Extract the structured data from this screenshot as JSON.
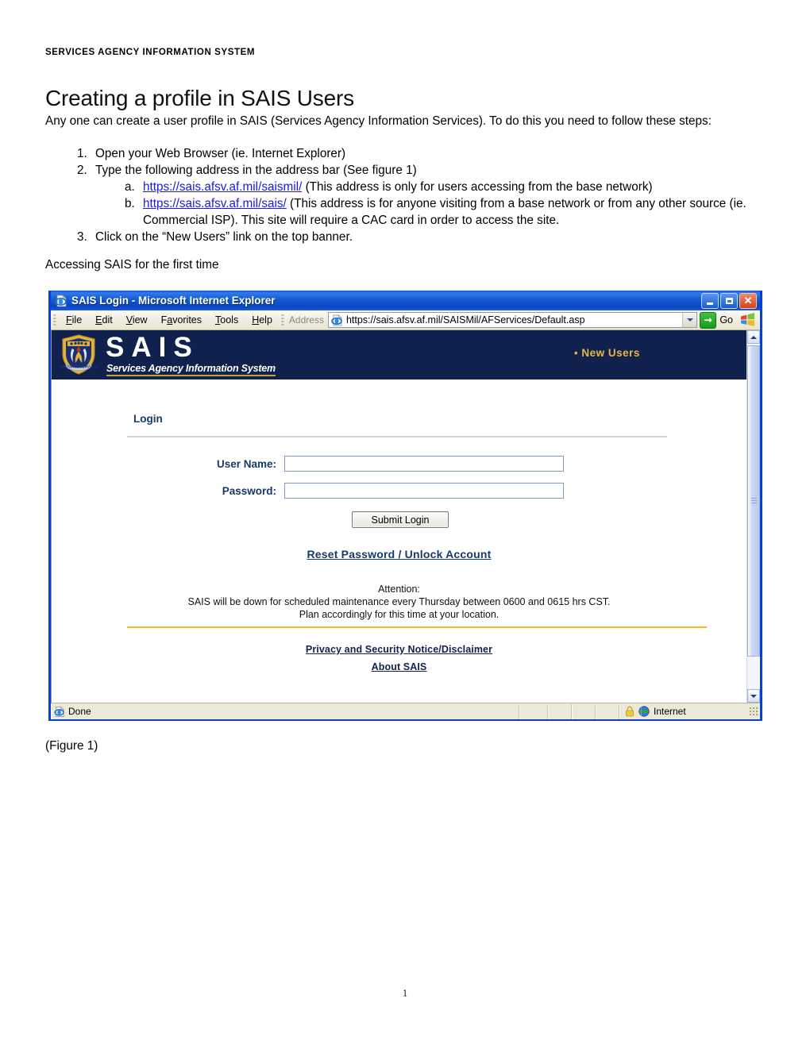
{
  "document": {
    "running_header": "SERVICES AGENCY INFORMATION SYSTEM",
    "title": "Creating a profile in SAIS Users",
    "intro": "Any one can create a user profile in SAIS (Services Agency Information Services). To do this you need to follow these steps:",
    "steps": [
      {
        "text": "Open your Web Browser (ie. Internet Explorer)"
      },
      {
        "text": "Type the following address in the address bar (See figure 1)",
        "substeps": [
          {
            "link": "https://sais.afsv.af.mil/saismil/",
            "rest": " (This address is only for users accessing from the base network)"
          },
          {
            "link": "https://sais.afsv.af.mil/sais/",
            "rest": " (This address is for anyone visiting from a base network or from any other source (ie. Commercial ISP). This site will require a CAC card in order to access the site."
          }
        ]
      },
      {
        "text": "Click on the “New Users” link on the top banner."
      }
    ],
    "section_label": "Accessing SAIS for the first time",
    "figure_caption": "(Figure 1)",
    "page_number": "1"
  },
  "browser": {
    "title": "SAIS Login - Microsoft Internet Explorer",
    "title_icon": "internet-explorer-icon",
    "window_buttons": {
      "minimize": "Minimize",
      "maximize": "Maximize",
      "close": "Close"
    },
    "menu": [
      {
        "label": "File",
        "accel": "F"
      },
      {
        "label": "Edit",
        "accel": "E"
      },
      {
        "label": "View",
        "accel": "V"
      },
      {
        "label": "Favorites",
        "accel": "a"
      },
      {
        "label": "Tools",
        "accel": "T"
      },
      {
        "label": "Help",
        "accel": "H"
      }
    ],
    "address": {
      "label": "Address",
      "value": "https://sais.afsv.af.mil/SAISMil/AFServices/Default.asp",
      "placeholder": "Address"
    },
    "go_label": "Go",
    "status": {
      "text": "Done",
      "zone": "Internet",
      "lock_icon": "padlock-icon",
      "globe_icon": "globe-icon"
    }
  },
  "sais_page": {
    "banner": {
      "wordmark": "SAIS",
      "tagline": "Services Agency Information System",
      "crest_icon": "air-force-services-crest-icon",
      "new_users_bullet": "•",
      "new_users_label": "New Users"
    },
    "login": {
      "heading": "Login",
      "username_label": "User Name:",
      "username_value": "",
      "password_label": "Password:",
      "password_value": "",
      "submit_label": "Submit Login",
      "reset_link": "Reset Password / Unlock Account"
    },
    "attention": {
      "line1": "Attention:",
      "line2": "SAIS will be down for scheduled maintenance every Thursday between 0600 and 0615 hrs CST.",
      "line3": "Plan accordingly for this time at your location."
    },
    "footer_links": [
      "Privacy and Security Notice/Disclaimer",
      "About SAIS"
    ]
  },
  "colors": {
    "banner_navy": "#10214e",
    "accent_gold": "#eab641",
    "rule_gold": "#f2b630",
    "link_blue": "#1a1ae0",
    "heading_blue": "#163a6b",
    "titlebar_blue": "#0b46c0"
  }
}
